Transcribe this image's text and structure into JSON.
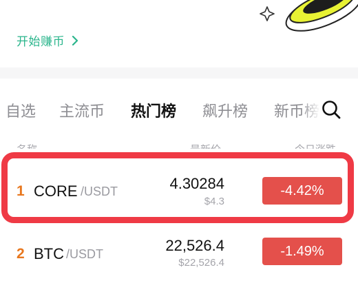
{
  "banner": {
    "earn_label": "开始赚币"
  },
  "tabs": [
    {
      "label": "自选",
      "active": false
    },
    {
      "label": "主流币",
      "active": false
    },
    {
      "label": "热门榜",
      "active": true
    },
    {
      "label": "飙升榜",
      "active": false
    },
    {
      "label": "新币榜",
      "active": false
    }
  ],
  "columns": {
    "name": "名称",
    "price": "最新价",
    "change": "今日涨跌"
  },
  "rows": [
    {
      "rank": "1",
      "symbol": "CORE",
      "quote": "/USDT",
      "price": "4.30284",
      "fiat": "$4.3",
      "change": "-4.42%",
      "highlighted": true
    },
    {
      "rank": "2",
      "symbol": "BTC",
      "quote": "/USDT",
      "price": "22,526.4",
      "fiat": "$22,526.4",
      "change": "-1.49%",
      "highlighted": false
    }
  ],
  "colors": {
    "accent_green": "#2bb58c",
    "rank_orange": "#e8771e",
    "down_red": "#e4504b",
    "highlight_red": "#ef3a45"
  },
  "icons": [
    "chevron-right-icon",
    "search-icon",
    "sparkle-icon"
  ]
}
